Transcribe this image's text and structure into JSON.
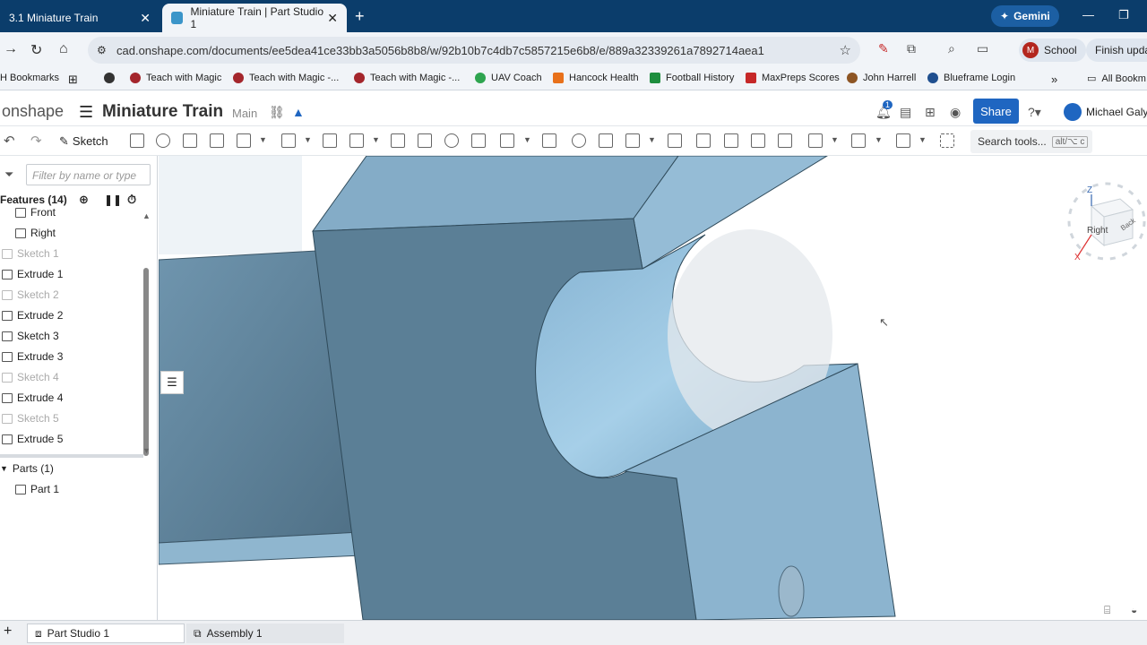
{
  "browser": {
    "tabs": [
      {
        "label": "3.1 Miniature Train",
        "active": false
      },
      {
        "label": "Miniature Train | Part Studio 1",
        "active": true
      }
    ],
    "gemini_label": "Gemini",
    "url": "cad.onshape.com/documents/ee5dea41ce33bb3a5056b8b8/w/92b10b7c4db7c5857215e6b8/e/889a32339261a7892714aea1",
    "profile_initial": "M",
    "profile_label": "School",
    "update_label": "Finish updat",
    "bookmarks": [
      "H Bookmarks",
      "Teach with Magic",
      "Teach with Magic -...",
      "Teach with Magic -...",
      "UAV Coach",
      "Hancock Health",
      "Football History",
      "MaxPreps Scores",
      "John Harrell",
      "Blueframe Login"
    ],
    "all_bookmarks": "All Bookm"
  },
  "app": {
    "logo": "onshape",
    "document_title": "Miniature Train",
    "branch": "Main",
    "notification_count": "1",
    "share_label": "Share",
    "user_name": "Michael Galy"
  },
  "toolbar": {
    "sketch_label": "Sketch",
    "search_label": "Search tools...",
    "search_shortcut": "alt/⌥ c"
  },
  "feature_panel": {
    "filter_placeholder": "Filter by name or type",
    "features_header": "Features (14)",
    "features": [
      {
        "label": "Front",
        "dim": false,
        "kind": "plane"
      },
      {
        "label": "Right",
        "dim": false,
        "kind": "plane"
      },
      {
        "label": "Sketch 1",
        "dim": true,
        "kind": "sketch"
      },
      {
        "label": "Extrude 1",
        "dim": false,
        "kind": "extrude"
      },
      {
        "label": "Sketch 2",
        "dim": true,
        "kind": "sketch"
      },
      {
        "label": "Extrude 2",
        "dim": false,
        "kind": "extrude"
      },
      {
        "label": "Sketch 3",
        "dim": false,
        "kind": "sketch"
      },
      {
        "label": "Extrude 3",
        "dim": false,
        "kind": "extrude"
      },
      {
        "label": "Sketch 4",
        "dim": true,
        "kind": "sketch"
      },
      {
        "label": "Extrude 4",
        "dim": false,
        "kind": "extrude"
      },
      {
        "label": "Sketch 5",
        "dim": true,
        "kind": "sketch"
      },
      {
        "label": "Extrude 5",
        "dim": false,
        "kind": "extrude"
      }
    ],
    "parts_header": "Parts (1)",
    "parts": [
      "Part 1"
    ]
  },
  "viewcube": {
    "face_label": "Right",
    "back_label": "Back",
    "z_label": "Z",
    "x_label": "X"
  },
  "bottom_tabs": [
    {
      "label": "Part Studio 1",
      "active": true
    },
    {
      "label": "Assembly 1",
      "active": false
    }
  ],
  "colors": {
    "browser_frame": "#0b3d6b",
    "share_button": "#1f66c1",
    "model_face": "#7fa9c6",
    "model_dark": "#4f7086"
  }
}
